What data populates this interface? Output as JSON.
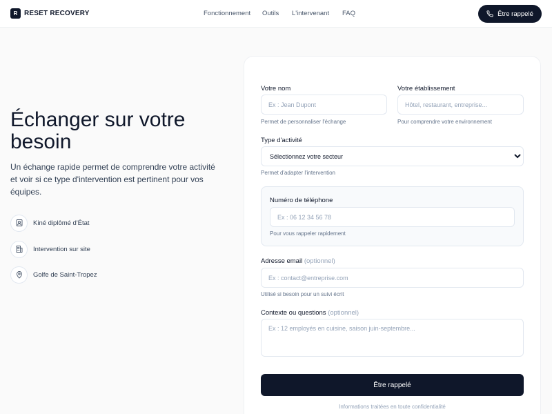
{
  "brand": {
    "mark": "R",
    "name": "RESET RECOVERY"
  },
  "nav": {
    "items": [
      "Fonctionnement",
      "Outils",
      "L'intervenant",
      "FAQ"
    ],
    "cta_label": "Être rappelé"
  },
  "hero": {
    "title": "Échanger sur votre besoin",
    "description": "Un échange rapide permet de comprendre votre activité et voir si ce type d'intervention est pertinent pour vos équipes.",
    "features": [
      {
        "icon": "badge-icon",
        "label": "Kiné diplômé d'État"
      },
      {
        "icon": "building-icon",
        "label": "Intervention sur site"
      },
      {
        "icon": "map-pin-icon",
        "label": "Golfe de Saint-Tropez"
      }
    ]
  },
  "form": {
    "name": {
      "label": "Votre nom",
      "placeholder": "Ex : Jean Dupont",
      "hint": "Permet de personnaliser l'échange"
    },
    "establishment": {
      "label": "Votre établissement",
      "placeholder": "Hôtel, restaurant, entreprise...",
      "hint": "Pour comprendre votre environnement"
    },
    "activity": {
      "label": "Type d'activité",
      "selected": "Sélectionnez votre secteur",
      "hint": "Permet d'adapter l'intervention"
    },
    "phone": {
      "label": "Numéro de téléphone",
      "placeholder": "Ex : 06 12 34 56 78",
      "hint": "Pour vous rappeler rapidement"
    },
    "email": {
      "label": "Adresse email",
      "optional": "(optionnel)",
      "placeholder": "Ex : contact@entreprise.com",
      "hint": "Utilisé si besoin pour un suivi écrit"
    },
    "context": {
      "label": "Contexte ou questions",
      "optional": "(optionnel)",
      "placeholder": "Ex : 12 employés en cuisine, saison juin-septembre..."
    },
    "submit_label": "Être rappelé",
    "privacy": "Informations traitées en toute confidentialité"
  }
}
